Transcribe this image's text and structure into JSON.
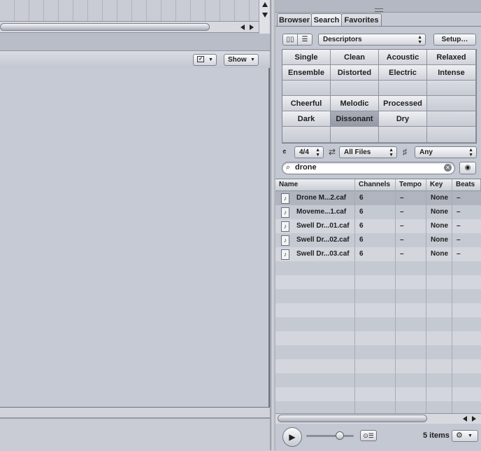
{
  "left": {
    "toolbar": {
      "show_label": "Show"
    }
  },
  "tabs": [
    {
      "label": "Browser"
    },
    {
      "label": "Search"
    },
    {
      "label": "Favorites"
    }
  ],
  "filters": {
    "view_mode": "Descriptors",
    "setup_label": "Setup…",
    "time_signature": "4/4",
    "file_type": "All Files",
    "key": "Any"
  },
  "keywords": [
    [
      "Single",
      "Clean",
      "Acoustic",
      "Relaxed"
    ],
    [
      "Ensemble",
      "Distorted",
      "Electric",
      "Intense"
    ],
    [
      "",
      "",
      "",
      ""
    ],
    [
      "Cheerful",
      "Melodic",
      "Processed",
      ""
    ],
    [
      "Dark",
      "Dissonant",
      "Dry",
      ""
    ],
    [
      "",
      "",
      "",
      ""
    ]
  ],
  "selected_keyword": "Dissonant",
  "search": {
    "value": "drone"
  },
  "results": {
    "columns": [
      "Name",
      "Channels",
      "Tempo",
      "Key",
      "Beats"
    ],
    "rows": [
      {
        "name": "Drone M...2.caf",
        "channels": "6",
        "tempo": "–",
        "key": "None",
        "beats": "–"
      },
      {
        "name": "Moveme...1.caf",
        "channels": "6",
        "tempo": "–",
        "key": "None",
        "beats": "–"
      },
      {
        "name": "Swell Dr...01.caf",
        "channels": "6",
        "tempo": "–",
        "key": "None",
        "beats": "–"
      },
      {
        "name": "Swell Dr...02.caf",
        "channels": "6",
        "tempo": "–",
        "key": "None",
        "beats": "–"
      },
      {
        "name": "Swell Dr...03.caf",
        "channels": "6",
        "tempo": "–",
        "key": "None",
        "beats": "–"
      }
    ]
  },
  "footer": {
    "items_count": "5 items"
  },
  "icons": {
    "play": "play-icon",
    "gear": "gear-icon",
    "search": "search-icon",
    "file": "audio-file-icon"
  }
}
